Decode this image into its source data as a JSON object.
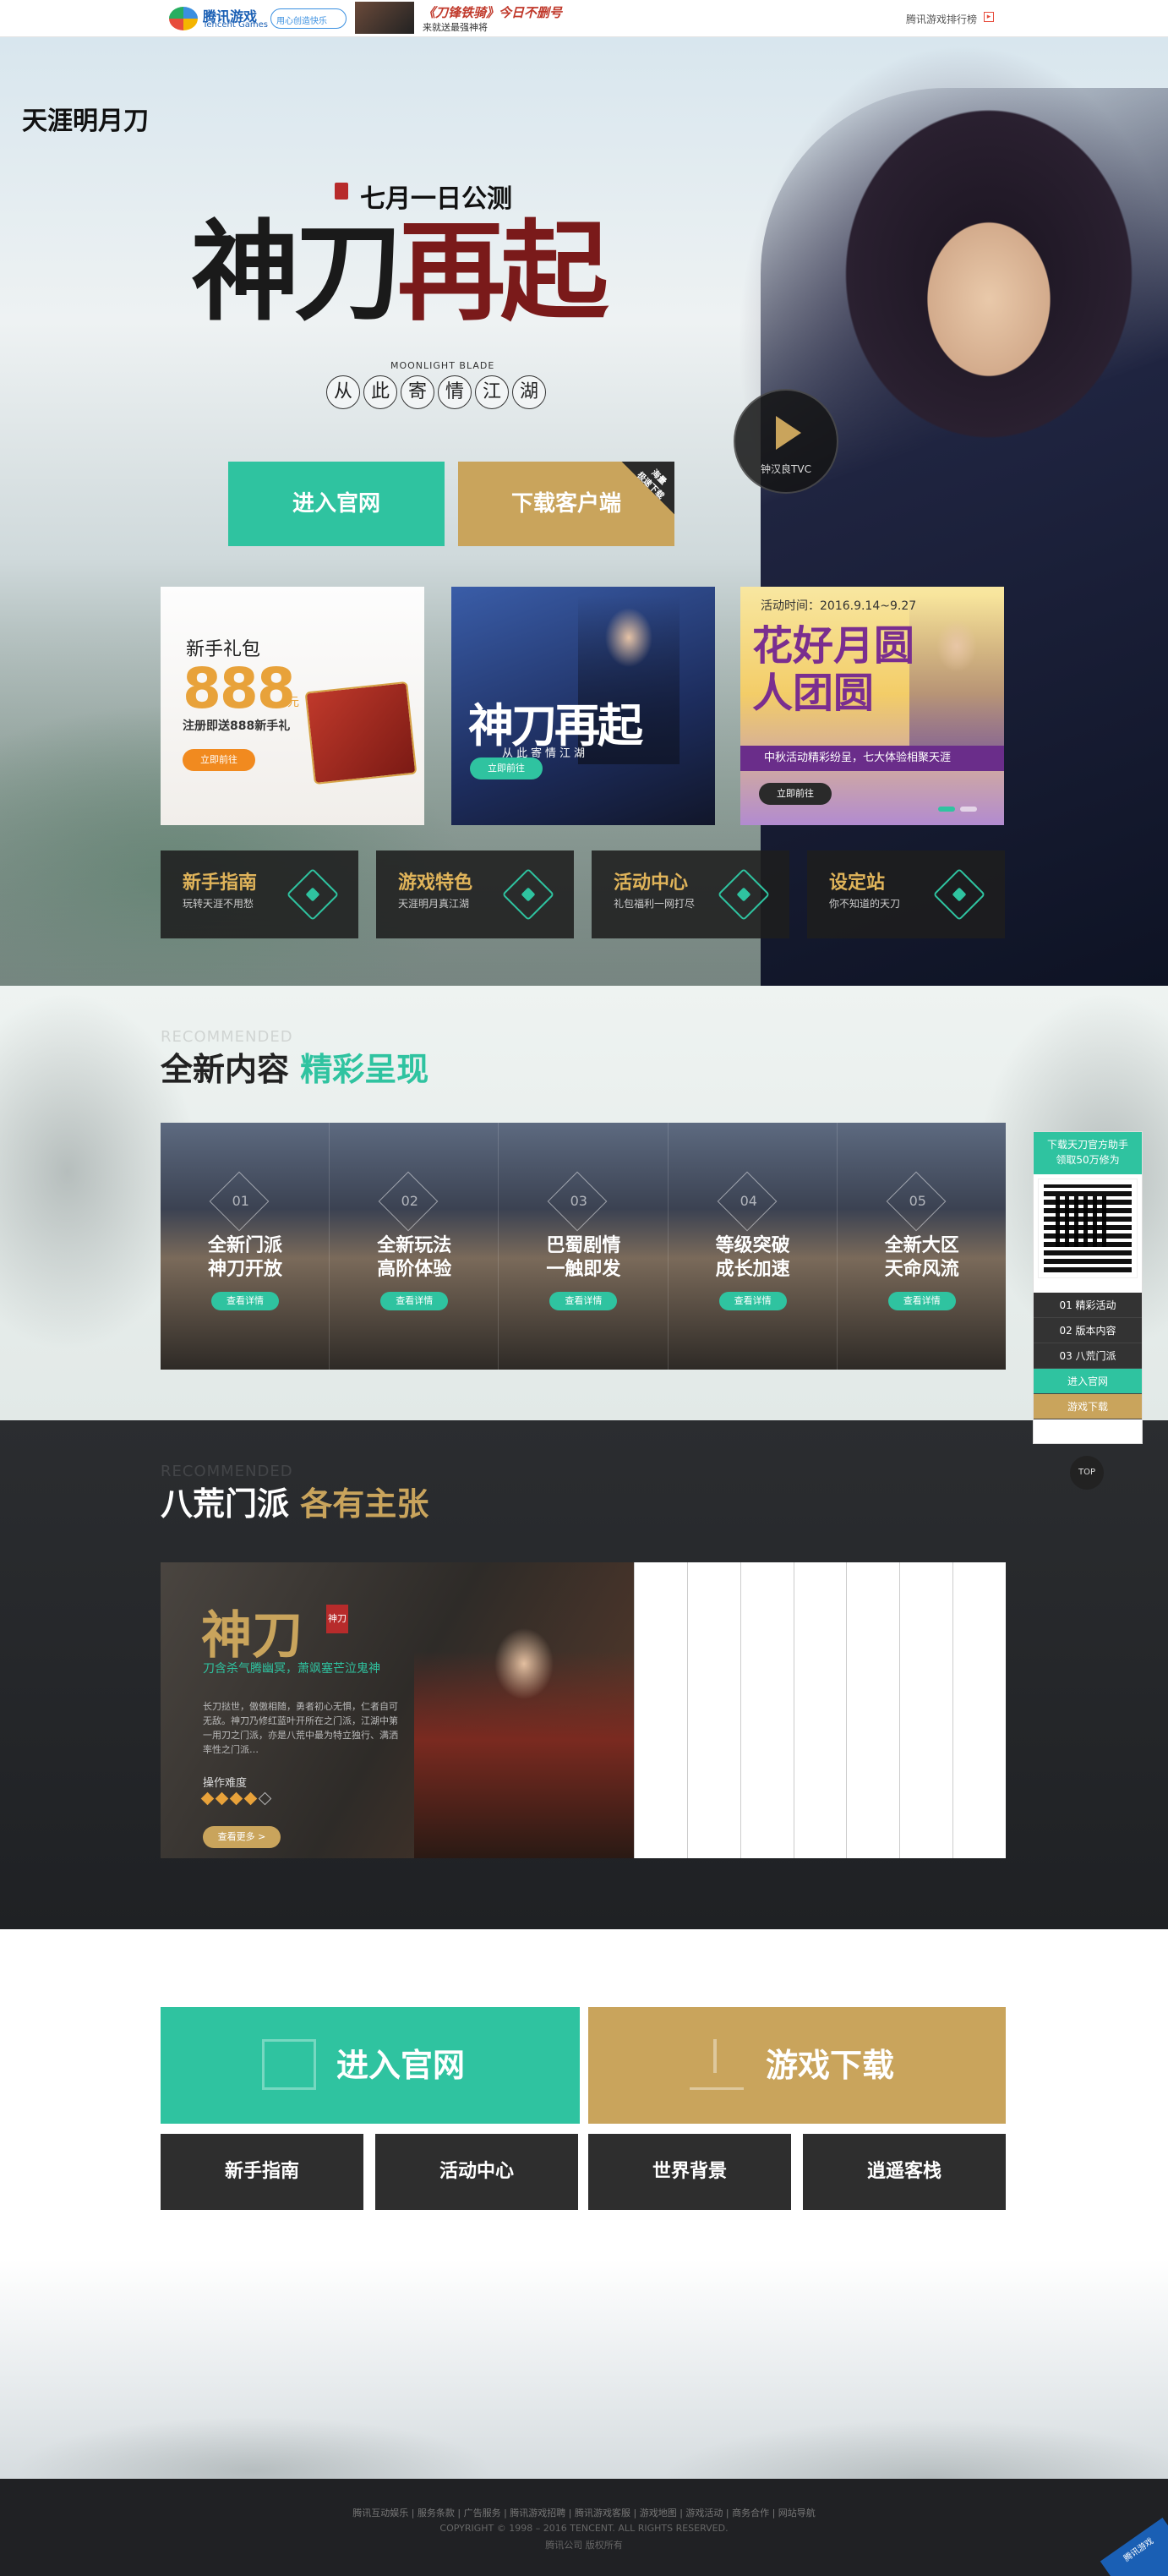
{
  "topbar": {
    "brand_cn": "腾讯游戏",
    "brand_en": "Tencent Games",
    "slogan": "用心创造快乐",
    "promo_title": "《刀锋铁骑》今日不删号",
    "promo_sub": "来就送最强神将",
    "rank_link": "腾讯游戏排行榜"
  },
  "hero": {
    "game_logo": "天涯明月刀",
    "launch_date": "七月一日公测",
    "calligraphy_1": "神刀",
    "calligraphy_2": "再起",
    "english": "MOONLIGHT BLADE",
    "subtitle_chars": [
      "从",
      "此",
      "寄",
      "情",
      "江",
      "湖"
    ],
    "tvc_label": "钟汉良TVC",
    "enter_button": "进入官网",
    "download_button": "下载客户端",
    "download_corner": "海量\n极速下载"
  },
  "promos": {
    "gift": {
      "title": "新手礼包",
      "amount": "888",
      "unit": "元",
      "desc": "注册即送888新手礼",
      "button": "立即前往"
    },
    "poster": {
      "calligraphy": "神刀再起",
      "sub": "从此寄情江湖",
      "button": "立即前往"
    },
    "event": {
      "time": "活动时间：2016.9.14~9.27",
      "title": "花好月圆人团圆",
      "bar": "中秋活动精彩纷呈，七大体验相聚天涯",
      "button": "立即前往"
    }
  },
  "nav_tiles": [
    {
      "title": "新手指南",
      "sub": "玩转天涯不用愁"
    },
    {
      "title": "游戏特色",
      "sub": "天涯明月真江湖"
    },
    {
      "title": "活动中心",
      "sub": "礼包福利一网打尽"
    },
    {
      "title": "设定站",
      "sub": "你不知道的天刀"
    }
  ],
  "section_new": {
    "recommended": "RECOMMENDED",
    "title_a": "全新内容",
    "title_b": "精彩呈现",
    "items": [
      {
        "num": "01",
        "line1": "全新门派",
        "line2": "神刀开放",
        "button": "查看详情"
      },
      {
        "num": "02",
        "line1": "全新玩法",
        "line2": "高阶体验",
        "button": "查看详情"
      },
      {
        "num": "03",
        "line1": "巴蜀剧情",
        "line2": "一触即发",
        "button": "查看详情"
      },
      {
        "num": "04",
        "line1": "等级突破",
        "line2": "成长加速",
        "button": "查看详情"
      },
      {
        "num": "05",
        "line1": "全新大区",
        "line2": "天命风流",
        "button": "查看详情"
      }
    ]
  },
  "side_float": {
    "head_1": "下载天刀官方助手",
    "head_2": "领取50万修为",
    "links": [
      "01 精彩活动",
      "02 版本内容",
      "03 八荒门派"
    ],
    "enter": "进入官网",
    "download": "游戏下载",
    "top": "TOP"
  },
  "section_factions": {
    "recommended": "RECOMMENDED",
    "title_a": "八荒门派",
    "title_b": "各有主张",
    "name": "神刀",
    "stamp": "神刀",
    "tagline": "刀含杀气腾幽冥，萧飒塞芒泣鬼神",
    "desc": "长刀挞世，傲傲相随，勇者初心无惧，仁者自可无敌。神刀乃修红蓝叶开所在之门派，江湖中第一用刀之门派，亦是八荒中最为特立独行、满洒率性之门派…",
    "difficulty_label": "操作难度",
    "difficulty": 4,
    "difficulty_max": 5,
    "more_button": "查看更多 >"
  },
  "bottom": {
    "enter": "进入官网",
    "download": "游戏下载",
    "sub_buttons": [
      "新手指南",
      "活动中心",
      "世界背景",
      "逍遥客栈"
    ]
  },
  "footer": {
    "links": "腾讯互动娱乐 | 服务条款 | 广告服务 | 腾讯游戏招聘 | 腾讯游戏客服 | 游戏地图 | 游戏活动 | 商务合作 | 网站导航",
    "copyright": "COPYRIGHT © 1998 – 2016 TENCENT. ALL RIGHTS RESERVED.",
    "rights": "腾讯公司 版权所有",
    "badge": "腾讯游戏"
  },
  "colors": {
    "accent_teal": "#2fc3a0",
    "accent_gold": "#c9a45c",
    "dark_tile": "#2e2e2e"
  }
}
